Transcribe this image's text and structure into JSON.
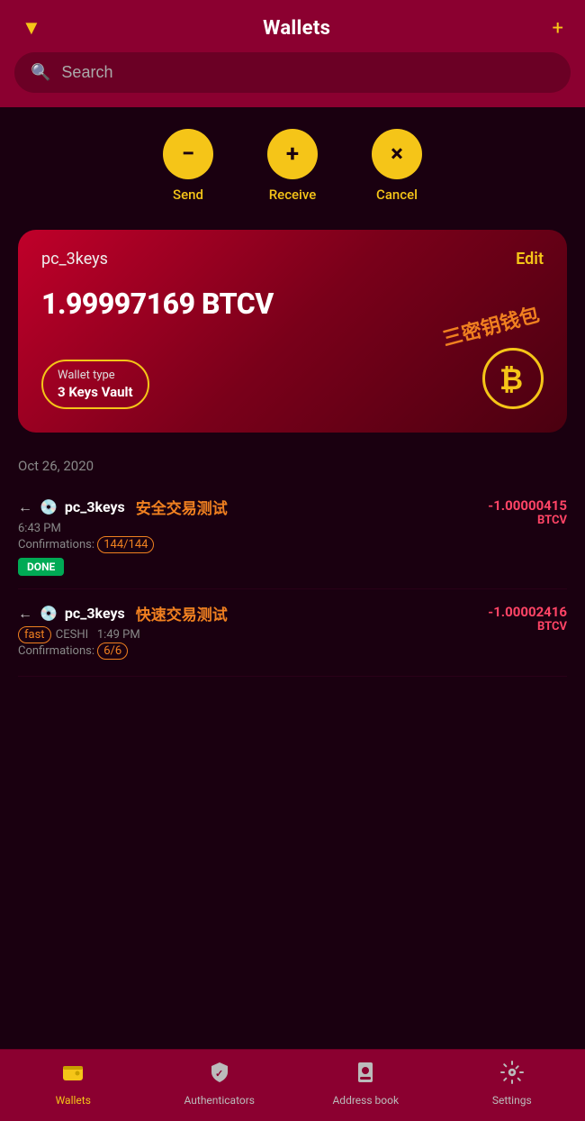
{
  "header": {
    "title": "Wallets",
    "filter_icon": "▼",
    "add_icon": "+"
  },
  "search": {
    "placeholder": "Search"
  },
  "actions": [
    {
      "key": "send",
      "icon": "−",
      "label": "Send"
    },
    {
      "key": "receive",
      "icon": "+",
      "label": "Receive"
    },
    {
      "key": "cancel",
      "icon": "×",
      "label": "Cancel"
    }
  ],
  "wallet_card": {
    "name": "pc_3keys",
    "edit_label": "Edit",
    "balance": "1.99997169 BTCV",
    "type_label": "Wallet type",
    "type_value": "3 Keys Vault",
    "annotation_cn": "三密钥钱包",
    "btc_symbol": "₿"
  },
  "date_separator": "Oct 26, 2020",
  "transactions": [
    {
      "id": "tx1",
      "arrow": "←",
      "wallet_icon": "🖫",
      "name": "pc_3keys",
      "annotation_cn": "安全交易测试",
      "time": "6:43 PM",
      "confirmations_label": "Confirmations:",
      "confirmations_value": "144/144",
      "status": "DONE",
      "amount": "-1.00000415",
      "currency": "BTCV",
      "fast_label": null
    },
    {
      "id": "tx2",
      "arrow": "←",
      "wallet_icon": "🖫",
      "name": "pc_3keys",
      "annotation_cn": "快速交易测试",
      "fast_prefix": "fast",
      "label2": "CESHI",
      "time": "1:49 PM",
      "confirmations_label": "Confirmations:",
      "confirmations_value": "6/6",
      "status": null,
      "amount": "-1.00002416",
      "currency": "BTCV"
    }
  ],
  "bottom_nav": [
    {
      "key": "wallets",
      "icon": "▣",
      "label": "Wallets",
      "active": true
    },
    {
      "key": "authenticators",
      "icon": "🛡",
      "label": "Authenticators",
      "active": false
    },
    {
      "key": "address-book",
      "icon": "👤",
      "label": "Address book",
      "active": false
    },
    {
      "key": "settings",
      "icon": "⚙",
      "label": "Settings",
      "active": false
    }
  ]
}
